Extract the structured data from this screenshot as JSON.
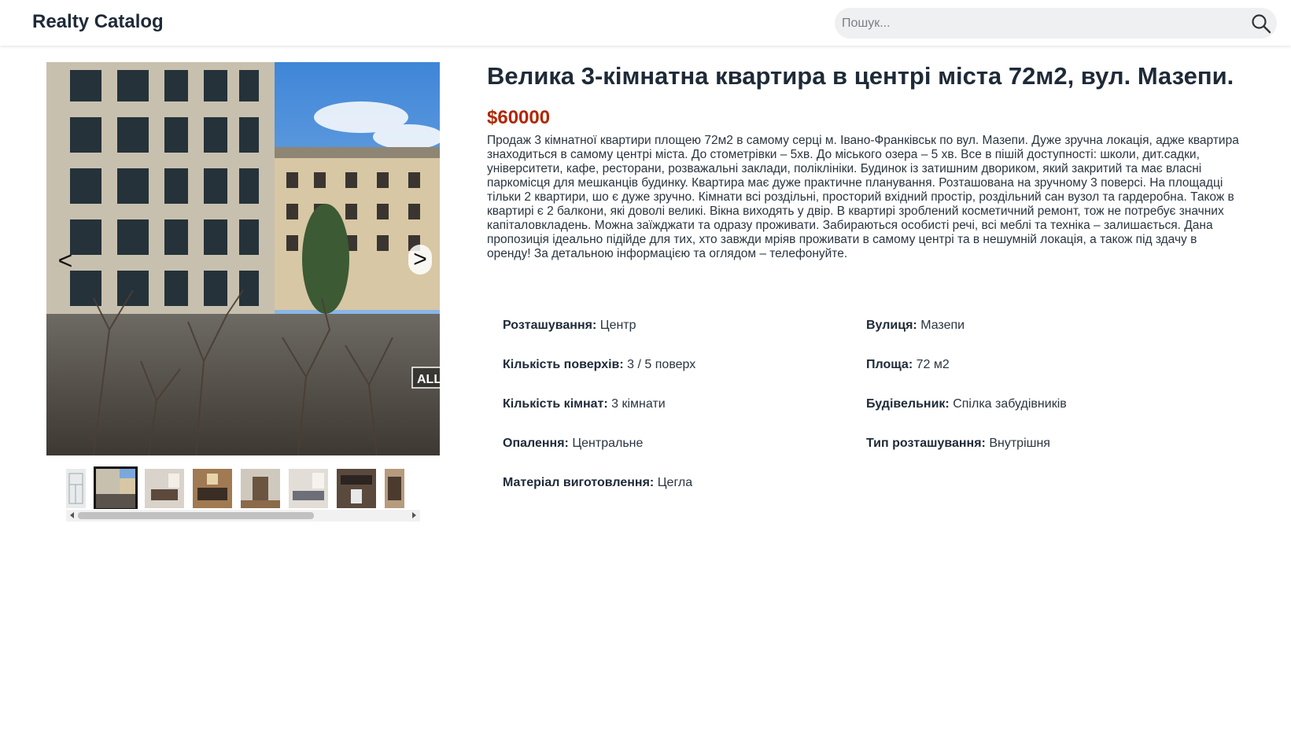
{
  "header": {
    "logo": "Realty Catalog",
    "search_placeholder": "Пошук...",
    "search_icon": "search-icon"
  },
  "gallery": {
    "prev_label": "<",
    "next_label": ">",
    "watermark": "ALL",
    "thumbnails_count": 8,
    "active_thumbnail": 1,
    "thumbnail_scroll_fraction": 0.0
  },
  "listing": {
    "title": "Велика 3-кімнатна квартира в центрі міста 72м2, вул. Мазепи.",
    "price": "$60000",
    "description": "Продаж 3 кімнатної квартири площею 72м2 в самому серці м. Івано-Франківськ по вул. Мазепи. Дуже зручна локація, адже квартира знаходиться в самому центрі міста. До стометрівки – 5хв. До міського озера – 5 хв. Все в пішій доступності: школи, дит.садки, університети, кафе, ресторани, розважальні заклади, поліклініки. Будинок із затишним двориком, який закритий та має власні паркомісця для мешканців будинку. Квартира має дуже практичне планування. Розташована на зручному 3 поверсі. На площадці тільки 2 квартири, шо є дуже зручно. Кімнати всі роздільні, просторий вхідний простір, роздільний сан вузол та гардеробна. Також в квартирі є 2 балкони, які доволі великі. Вікна виходять у двір. В квартирі зроблений косметичний ремонт, тож не потребує значних капіталовкладень. Можна заїжджати та одразу проживати. Забираються особисті речі, всі меблі та техніка – залишається. Дана пропозиція ідеально підійде для тих, хто завжди мріяв проживати в самому центрі та в нешумній локація, а також під здачу в оренду! За детальною інформацією та оглядом – телефонуйте.",
    "attributes": [
      {
        "label": "Розташування:",
        "value": "Центр"
      },
      {
        "label": "Вулиця:",
        "value": "Мазепи"
      },
      {
        "label": "Кількість поверхів:",
        "value": "3 / 5 поверх"
      },
      {
        "label": "Площа:",
        "value": "72 м2"
      },
      {
        "label": "Кількість кімнат:",
        "value": "3 кімнати"
      },
      {
        "label": "Будівельник:",
        "value": "Спілка забудівників"
      },
      {
        "label": "Опалення:",
        "value": "Центральне"
      },
      {
        "label": "Тип розташування:",
        "value": "Внутрішня"
      },
      {
        "label": "Матеріал виготовлення:",
        "value": "Цегла"
      }
    ]
  }
}
